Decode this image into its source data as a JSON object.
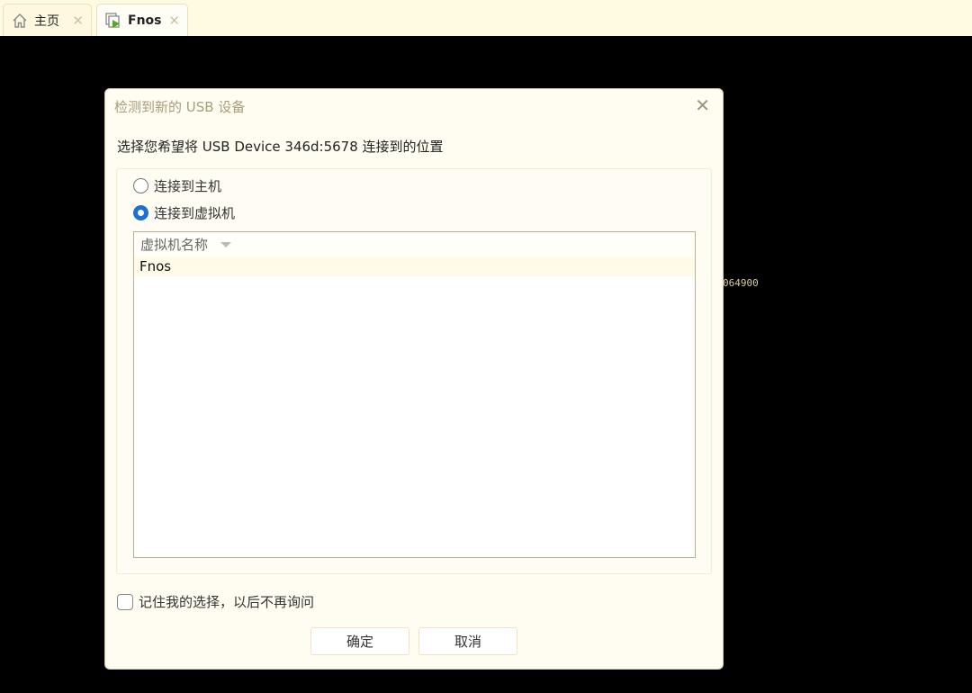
{
  "tabs": [
    {
      "label": "主页",
      "icon": "home-icon"
    },
    {
      "label": "Fnos",
      "icon": "vm-running-icon"
    }
  ],
  "console_text": "064900",
  "dialog": {
    "title": "检测到新的 USB 设备",
    "prompt": "选择您希望将 USB Device 346d:5678 连接到的位置",
    "options": [
      {
        "label": "连接到主机",
        "selected": false
      },
      {
        "label": "连接到虚拟机",
        "selected": true
      }
    ],
    "list_header": "虚拟机名称",
    "vms": [
      "Fnos"
    ],
    "remember_label": "记住我的选择，以后不再询问",
    "remember_checked": false,
    "ok_label": "确定",
    "cancel_label": "取消"
  },
  "colors": {
    "radio_selected": "#1e6fd0",
    "vm_play": "#4caf1a"
  }
}
